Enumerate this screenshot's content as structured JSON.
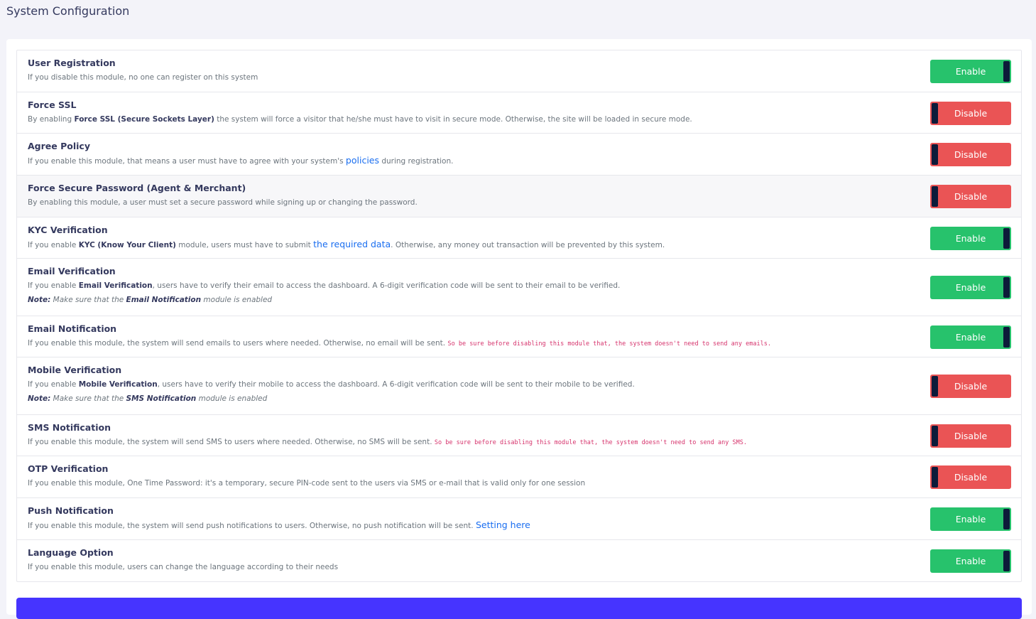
{
  "page_title": "System Configuration",
  "enable_label": "Enable",
  "disable_label": "Disable",
  "settings": [
    {
      "key": "user-registration",
      "height": 59,
      "title": "User Registration",
      "state": "on",
      "desc": [
        {
          "t": "If you disable this module, no one can register on this system"
        }
      ]
    },
    {
      "key": "force-ssl",
      "height": 58,
      "title": "Force SSL",
      "state": "off",
      "desc": [
        {
          "t": "By enabling "
        },
        {
          "t": "Force SSL (Secure Sockets Layer)",
          "s": "b"
        },
        {
          "t": " the system will force a visitor that he/she must have to visit in secure mode. Otherwise, the site will be loaded in secure mode."
        }
      ]
    },
    {
      "key": "agree-policy",
      "height": 59,
      "title": "Agree Policy",
      "state": "off",
      "desc": [
        {
          "t": "If you enable this module, that means a user must have to agree with your system's "
        },
        {
          "t": "policies",
          "s": "link"
        },
        {
          "t": " during registration."
        }
      ]
    },
    {
      "key": "force-secure-password",
      "height": 59,
      "title": "Force Secure Password (Agent & Merchant)",
      "state": "off",
      "hl": true,
      "desc": [
        {
          "t": "By enabling this module, a user must set a secure password while signing up or changing the password."
        }
      ]
    },
    {
      "key": "kyc-verification",
      "height": 58,
      "title": "KYC Verification",
      "state": "on",
      "desc": [
        {
          "t": "If you enable "
        },
        {
          "t": "KYC (Know Your Client)",
          "s": "b"
        },
        {
          "t": " module, users must have to submit "
        },
        {
          "t": "the required data",
          "s": "link"
        },
        {
          "t": ". Otherwise, any money out transaction will be prevented by this system."
        }
      ]
    },
    {
      "key": "email-verification",
      "height": 81,
      "title": "Email Verification",
      "state": "on",
      "desc": [
        {
          "t": "If you enable "
        },
        {
          "t": "Email Verification",
          "s": "b"
        },
        {
          "t": ", users have to verify their email to access the dashboard. A 6-digit verification code will be sent to their email to be verified."
        }
      ],
      "note": [
        {
          "t": "Note:",
          "s": "b"
        },
        {
          "t": " Make sure that the "
        },
        {
          "t": "Email Notification",
          "s": "b"
        },
        {
          "t": " module is enabled"
        }
      ]
    },
    {
      "key": "email-notification",
      "height": 58,
      "title": "Email Notification",
      "state": "on",
      "desc": [
        {
          "t": "If you enable this module, the system will send emails to users where needed. Otherwise, no email will be sent. "
        },
        {
          "t": "So be sure before disabling this module that, the system doesn't need to send any emails.",
          "s": "code"
        }
      ]
    },
    {
      "key": "mobile-verification",
      "height": 81,
      "title": "Mobile Verification",
      "state": "off",
      "desc": [
        {
          "t": "If you enable "
        },
        {
          "t": "Mobile Verification",
          "s": "b"
        },
        {
          "t": ", users have to verify their mobile to access the dashboard. A 6-digit verification code will be sent to their mobile to be verified."
        }
      ],
      "note": [
        {
          "t": "Note:",
          "s": "b"
        },
        {
          "t": " Make sure that the "
        },
        {
          "t": "SMS Notification",
          "s": "b"
        },
        {
          "t": " module is enabled"
        }
      ]
    },
    {
      "key": "sms-notification",
      "height": 58,
      "title": "SMS Notification",
      "state": "off",
      "desc": [
        {
          "t": "If you enable this module, the system will send SMS to users where needed. Otherwise, no SMS will be sent. "
        },
        {
          "t": "So be sure before disabling this module that, the system doesn't need to send any SMS.",
          "s": "code"
        }
      ]
    },
    {
      "key": "otp-verification",
      "height": 59,
      "title": "OTP Verification",
      "state": "off",
      "desc": [
        {
          "t": "If you enable this module, One Time Password: it's a temporary, secure PIN-code sent to the users via SMS or e-mail that is valid only for one session"
        }
      ]
    },
    {
      "key": "push-notification",
      "height": 59,
      "title": "Push Notification",
      "state": "on",
      "desc": [
        {
          "t": "If you enable this module, the system will send push notifications to users. Otherwise, no push notification will be sent. "
        },
        {
          "t": "Setting here",
          "s": "link"
        }
      ]
    },
    {
      "key": "language-option",
      "height": 58,
      "title": "Language Option",
      "state": "on",
      "desc": [
        {
          "t": "If you enable this module, users can change the language according to their needs"
        }
      ]
    }
  ]
}
